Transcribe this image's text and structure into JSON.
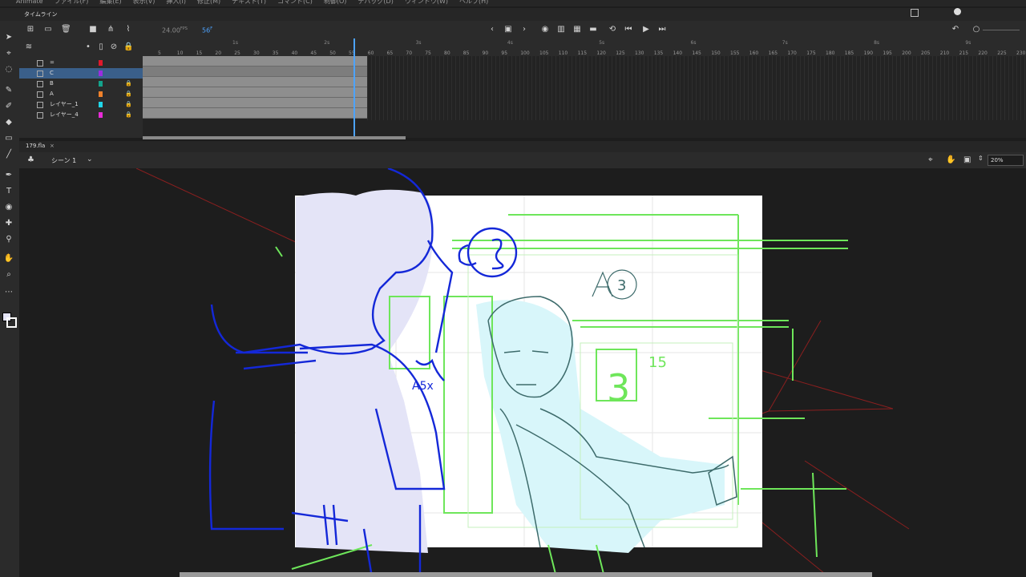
{
  "menubar": {
    "items": [
      "Animate",
      "ファイル(F)",
      "編集(E)",
      "表示(V)",
      "挿入(I)",
      "修正(M)",
      "テキスト(T)",
      "コマンド(C)",
      "制御(O)",
      "デバッグ(D)",
      "ウィンドウ(W)",
      "ヘルプ(H)"
    ]
  },
  "timeline": {
    "tab_label": "タイムライン",
    "fps_value": "24.00",
    "fps_unit": "FPS",
    "current_frame": "56",
    "frame_unit": "F",
    "ruler_seconds": [
      "1s",
      "2s",
      "3s",
      "4s",
      "5s",
      "6s",
      "7s",
      "8s",
      "9s"
    ],
    "ruler_ticks": [
      "5",
      "10",
      "15",
      "20",
      "25",
      "30",
      "35",
      "40",
      "45",
      "50",
      "55",
      "60",
      "65",
      "70",
      "75",
      "80",
      "85",
      "90",
      "95",
      "100",
      "105",
      "110",
      "115",
      "120",
      "125",
      "130",
      "135",
      "140",
      "145",
      "150",
      "155",
      "160",
      "165",
      "170",
      "175",
      "180",
      "185",
      "190",
      "195",
      "200",
      "205",
      "210",
      "215",
      "220",
      "225",
      "230"
    ],
    "layers": [
      {
        "name": "=",
        "color": "#e0192b",
        "locked": false,
        "selected": false
      },
      {
        "name": "C",
        "color": "#9b2de0",
        "locked": false,
        "selected": true
      },
      {
        "name": "B",
        "color": "#13a38c",
        "locked": true,
        "selected": false
      },
      {
        "name": "A",
        "color": "#f0812b",
        "locked": true,
        "selected": false
      },
      {
        "name": "レイヤー_1",
        "color": "#21d6e8",
        "locked": true,
        "selected": false
      },
      {
        "name": "レイヤー_4",
        "color": "#e82bd8",
        "locked": true,
        "selected": false
      }
    ]
  },
  "document": {
    "filename": "179.fla",
    "close_glyph": "×",
    "scene_label": "シーン 1",
    "zoom": "20%"
  },
  "colors": {
    "accent": "#4da3ff",
    "panel": "#2b2b2b",
    "stage_bg": "#1d1d1d"
  },
  "tool_icons": [
    "selection-icon",
    "subselection-icon",
    "lasso-icon",
    "brush-icon",
    "paint-brush-icon",
    "eraser-icon",
    "rectangle-icon",
    "line-icon",
    "pen-icon",
    "text-icon",
    "paint-bucket-icon",
    "eyedropper-icon",
    "pin-icon",
    "hand-icon",
    "zoom-icon",
    "more-icon"
  ],
  "sketch_notes": {
    "c_label": "C",
    "c_number": "3",
    "a_label": "A",
    "a_number": "3",
    "small_note": "A5x",
    "box_number": "3",
    "box_note": "15"
  }
}
